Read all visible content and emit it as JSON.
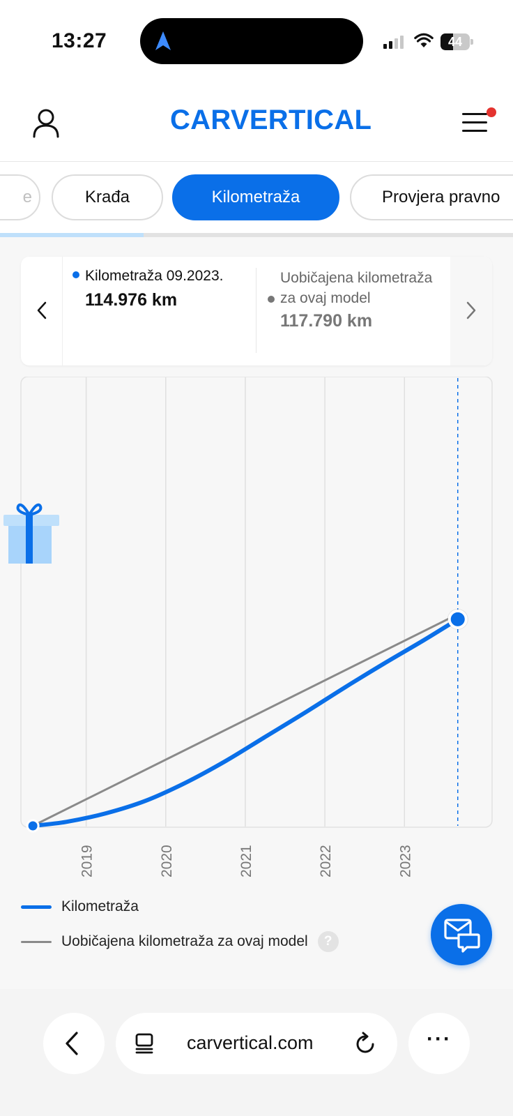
{
  "status": {
    "time": "13:27",
    "battery": "44",
    "battery_level": 0.44
  },
  "header": {
    "logo": "CARVERTICAL",
    "icons": [
      "user-icon",
      "menu-icon"
    ]
  },
  "tabs": [
    {
      "label": "e",
      "active": false
    },
    {
      "label": "Krađa",
      "active": false
    },
    {
      "label": "Kilometraža",
      "active": true
    },
    {
      "label": "Provjera pravno",
      "active": false
    }
  ],
  "tab_scroll_progress": 0.28,
  "info_card": {
    "current_label": "Kilometraža 09.2023.",
    "current_value": "114.976 km",
    "typical_label": "Uobičajena kilometraža za ovaj model",
    "typical_value": "117.790 km"
  },
  "colors": {
    "accent": "#0a6fe8",
    "typical_line": "#8a8a8a",
    "notification": "#e4332f"
  },
  "chart_data": {
    "type": "line",
    "x_ticks": [
      "2019",
      "2020",
      "2021",
      "2022",
      "2023"
    ],
    "xlim": [
      2018.25,
      2023.9
    ],
    "ylim": [
      0,
      250000
    ],
    "grid": true,
    "series": [
      {
        "name": "Kilometraža",
        "x": [
          2018.33,
          2018.75,
          2019.25,
          2019.75,
          2020.25,
          2020.75,
          2021.25,
          2021.75,
          2022.25,
          2022.75,
          2023.25,
          2023.67
        ],
        "y": [
          0,
          2200,
          7000,
          14000,
          24000,
          36000,
          49500,
          63000,
          77000,
          90500,
          103500,
          114976
        ]
      },
      {
        "name": "Uobičajena kilometraža za ovaj model",
        "x": [
          2018.33,
          2023.67
        ],
        "y": [
          0,
          117790
        ]
      }
    ]
  },
  "legend": {
    "item1": "Kilometraža",
    "item2": "Uobičajena kilometraža za ovaj model",
    "help": "?"
  },
  "browser": {
    "url": "carvertical.com",
    "more": "···"
  }
}
